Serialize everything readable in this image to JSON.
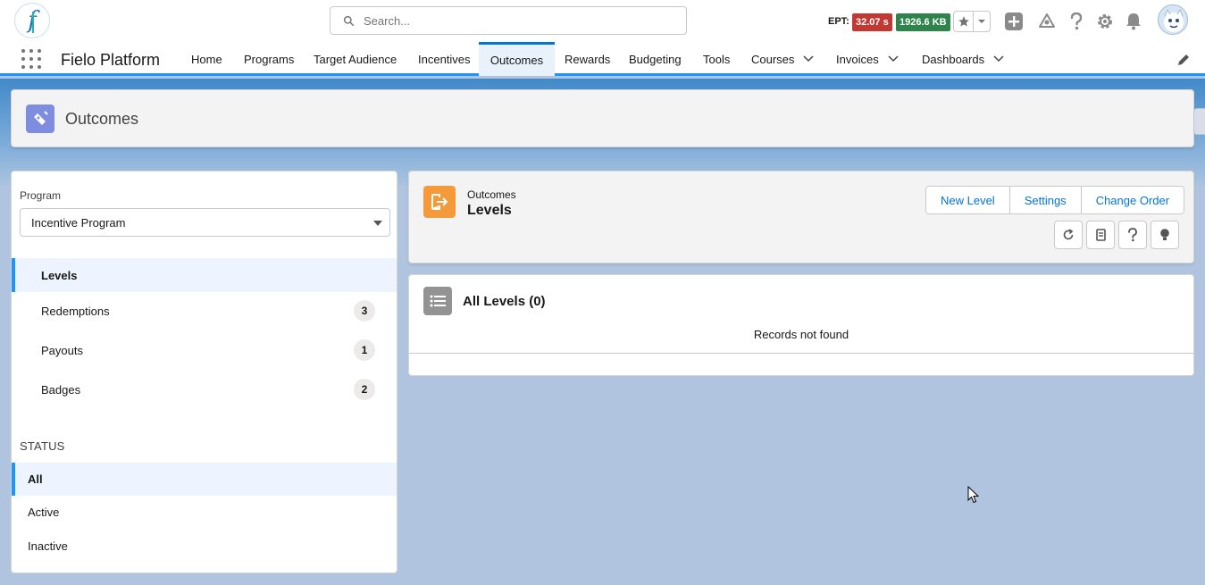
{
  "header": {
    "search_placeholder": "Search...",
    "ept_label": "EPT:",
    "ept_time": "32.07 s",
    "ept_size": "1926.6 KB"
  },
  "nav": {
    "app_name": "Fielo Platform",
    "items": [
      {
        "label": "Home"
      },
      {
        "label": "Programs"
      },
      {
        "label": "Target Audience"
      },
      {
        "label": "Incentives"
      },
      {
        "label": "Outcomes"
      },
      {
        "label": "Rewards"
      },
      {
        "label": "Budgeting"
      },
      {
        "label": "Tools"
      },
      {
        "label": "Courses"
      },
      {
        "label": "Invoices"
      },
      {
        "label": "Dashboards"
      }
    ],
    "active": "Outcomes"
  },
  "page": {
    "title": "Outcomes"
  },
  "left": {
    "program_label": "Program",
    "program_value": "Incentive Program",
    "items": [
      {
        "label": "Levels",
        "count": ""
      },
      {
        "label": "Redemptions",
        "count": "3"
      },
      {
        "label": "Payouts",
        "count": "1"
      },
      {
        "label": "Badges",
        "count": "2"
      }
    ],
    "status_title": "STATUS",
    "status_items": [
      {
        "label": "All"
      },
      {
        "label": "Active"
      },
      {
        "label": "Inactive"
      }
    ]
  },
  "record": {
    "object": "Outcomes",
    "title": "Levels",
    "buttons": {
      "new_level": "New Level",
      "settings": "Settings",
      "change_order": "Change Order"
    }
  },
  "list": {
    "title": "All Levels (0)",
    "empty": "Records not found"
  },
  "colors": {
    "accent": "#0176d3",
    "active_tab_bg": "#e9f1fb",
    "ept_red": "#c23934",
    "ept_green": "#2e844a",
    "outcomes_icon": "#7f8de1",
    "levels_icon": "#f49a3b"
  }
}
